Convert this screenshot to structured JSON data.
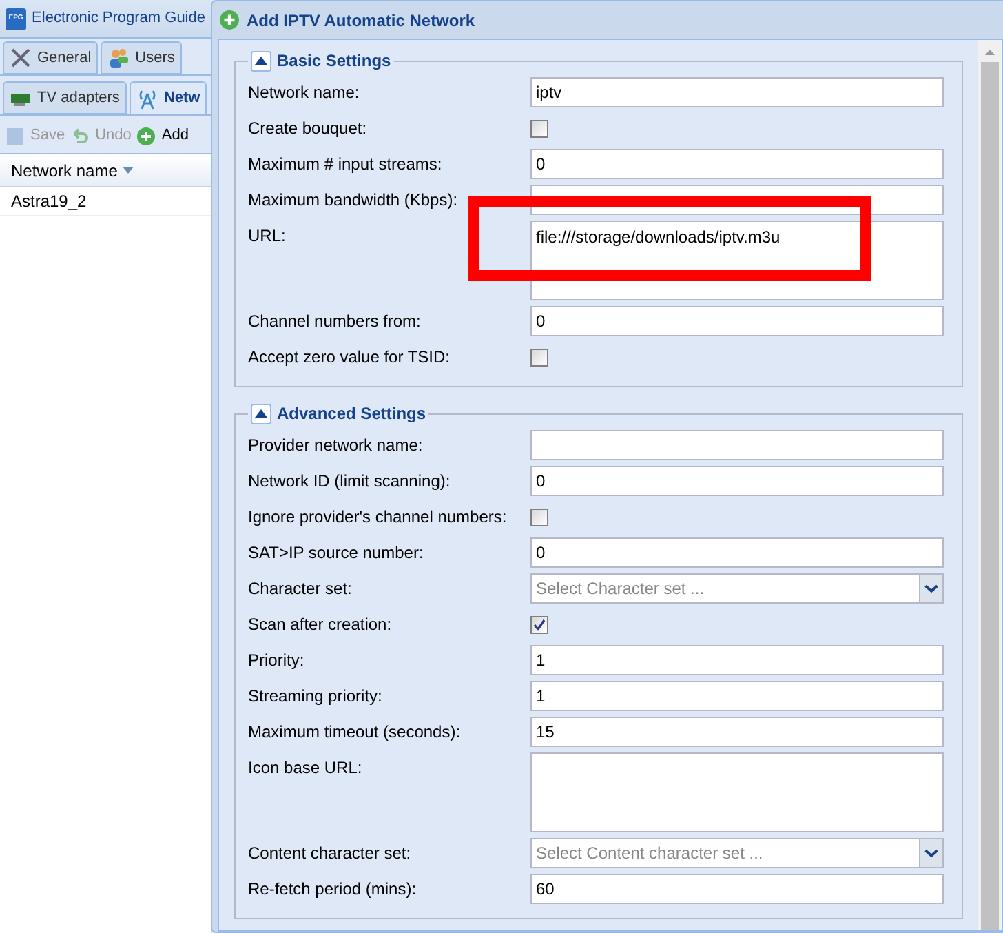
{
  "app": {
    "title": "Electronic Program Guide",
    "logo": "EPG",
    "tabs": [
      {
        "label": "General",
        "selected": false
      },
      {
        "label": "Users",
        "selected": false
      }
    ],
    "subtabs": [
      {
        "label": "TV adapters",
        "selected": false
      },
      {
        "label": "Netw",
        "selected": true
      }
    ],
    "toolbar": [
      {
        "label": "Save",
        "disabled": true
      },
      {
        "label": "Undo",
        "disabled": true
      },
      {
        "label": "Add",
        "disabled": false
      }
    ],
    "grid": {
      "column": "Network name",
      "rows": [
        "Astra19_2"
      ]
    }
  },
  "dialog": {
    "title": "Add IPTV Automatic Network",
    "sections": [
      {
        "title": "Basic Settings",
        "expanded": true,
        "fields": [
          {
            "kind": "text",
            "label": "Network name:",
            "value": "iptv"
          },
          {
            "kind": "checkbox",
            "label": "Create bouquet:",
            "checked": false
          },
          {
            "kind": "text",
            "label": "Maximum # input streams:",
            "value": "0"
          },
          {
            "kind": "text",
            "label": "Maximum bandwidth (Kbps):"
          },
          {
            "kind": "textarea",
            "label": "URL:",
            "value": "file:///storage/downloads/iptv.m3u",
            "highlighted": true
          },
          {
            "kind": "text",
            "label": "Channel numbers from:",
            "value": "0"
          },
          {
            "kind": "checkbox",
            "label": "Accept zero value for TSID:",
            "checked": false
          }
        ]
      },
      {
        "title": "Advanced Settings",
        "expanded": true,
        "fields": [
          {
            "kind": "text",
            "label": "Provider network name:"
          },
          {
            "kind": "text",
            "label": "Network ID (limit scanning):",
            "value": "0"
          },
          {
            "kind": "checkbox",
            "label": "Ignore provider's channel numbers:",
            "checked": false
          },
          {
            "kind": "text",
            "label": "SAT>IP source number:",
            "value": "0"
          },
          {
            "kind": "select",
            "label": "Character set:",
            "placeholder": "Select Character set ..."
          },
          {
            "kind": "checkbox",
            "label": "Scan after creation:",
            "checked": true
          },
          {
            "kind": "text",
            "label": "Priority:",
            "value": "1"
          },
          {
            "kind": "text",
            "label": "Streaming priority:",
            "value": "1"
          },
          {
            "kind": "text",
            "label": "Maximum timeout (seconds):",
            "value": "15"
          },
          {
            "kind": "textarea",
            "label": "Icon base URL:",
            "highlighted": false
          },
          {
            "kind": "select",
            "label": "Content character set:",
            "placeholder": "Select Content character set ..."
          },
          {
            "kind": "text",
            "label": "Re-fetch period (mins):",
            "value": "60"
          }
        ]
      }
    ]
  }
}
